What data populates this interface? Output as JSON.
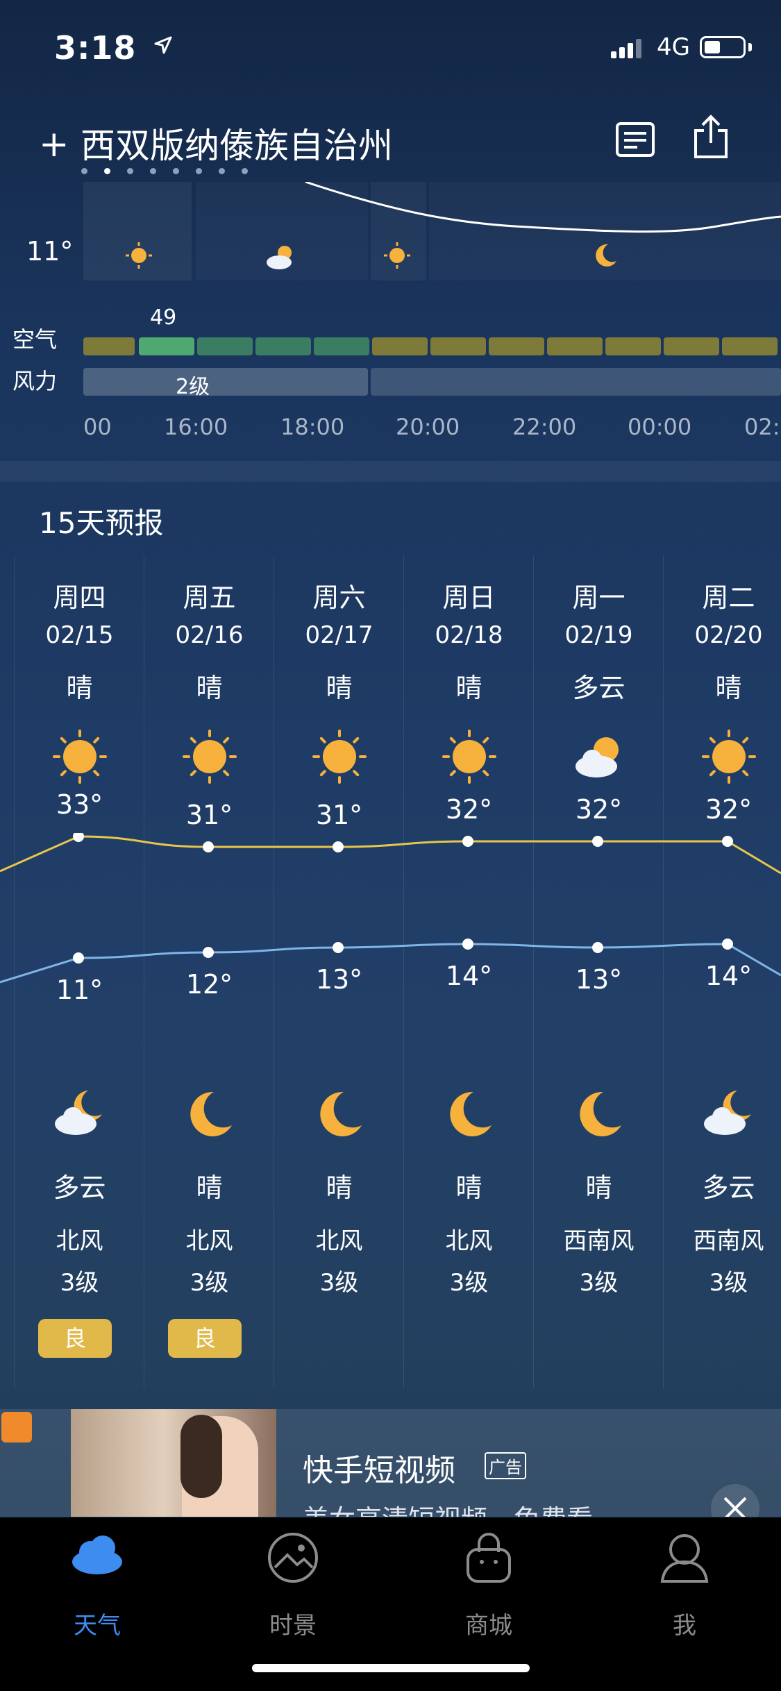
{
  "status": {
    "time": "3:18",
    "network": "4G"
  },
  "header": {
    "city": "西双版纳傣族自治州",
    "add_label": "+",
    "page_count": 8,
    "active_page": 1
  },
  "hourly": {
    "low_temp": "11°",
    "air_label": "空气",
    "wind_label": "风力",
    "aqi_value": "49",
    "wind_level": "2级",
    "times": [
      "00",
      "16:00",
      "18:00",
      "20:00",
      "22:00",
      "00:00",
      "02:"
    ],
    "colors": {
      "aqi_moderate": "#7d7a3a",
      "aqi_good_bright": "#4fa86f",
      "aqi_good": "#3a7d62"
    }
  },
  "forecast": {
    "title": "15天预报",
    "days": [
      {
        "day": "周四",
        "date": "02/15",
        "cond_day": "晴",
        "icon_day": "sun-icon",
        "high": "33°",
        "high_val": 33,
        "low": "11°",
        "low_val": 11,
        "icon_night": "cloud-moon-icon",
        "cond_night": "多云",
        "wind_dir": "北风",
        "wind_lvl": "3级",
        "aqi": "良"
      },
      {
        "day": "周五",
        "date": "02/16",
        "cond_day": "晴",
        "icon_day": "sun-icon",
        "high": "31°",
        "high_val": 31,
        "low": "12°",
        "low_val": 12,
        "icon_night": "moon-icon",
        "cond_night": "晴",
        "wind_dir": "北风",
        "wind_lvl": "3级",
        "aqi": "良"
      },
      {
        "day": "周六",
        "date": "02/17",
        "cond_day": "晴",
        "icon_day": "sun-icon",
        "high": "31°",
        "high_val": 31,
        "low": "13°",
        "low_val": 13,
        "icon_night": "moon-icon",
        "cond_night": "晴",
        "wind_dir": "北风",
        "wind_lvl": "3级",
        "aqi": ""
      },
      {
        "day": "周日",
        "date": "02/18",
        "cond_day": "晴",
        "icon_day": "sun-icon",
        "high": "32°",
        "high_val": 32,
        "low": "14°",
        "low_val": 14,
        "icon_night": "moon-icon",
        "cond_night": "晴",
        "wind_dir": "北风",
        "wind_lvl": "3级",
        "aqi": ""
      },
      {
        "day": "周一",
        "date": "02/19",
        "cond_day": "多云",
        "icon_day": "cloud-sun-icon",
        "high": "32°",
        "high_val": 32,
        "low": "13°",
        "low_val": 13,
        "icon_night": "moon-icon",
        "cond_night": "晴",
        "wind_dir": "西南风",
        "wind_lvl": "3级",
        "aqi": ""
      },
      {
        "day": "周二",
        "date": "02/20",
        "cond_day": "晴",
        "icon_day": "sun-icon",
        "high": "32°",
        "high_val": 32,
        "low": "14°",
        "low_val": 14,
        "icon_night": "cloud-moon-icon",
        "cond_night": "多云",
        "wind_dir": "西南风",
        "wind_lvl": "3级",
        "aqi": ""
      }
    ],
    "colors": {
      "high_line": "#e8c64a",
      "low_line": "#7fb6e6",
      "aqi_badge": "#e1b94a"
    }
  },
  "ad": {
    "title": "快手短视频",
    "tag": "广告",
    "subtitle": "美女高清短视频，免费看"
  },
  "tabbar": {
    "items": [
      {
        "label": "天气",
        "icon": "cloud-icon",
        "active": true
      },
      {
        "label": "时景",
        "icon": "photo-icon",
        "active": false
      },
      {
        "label": "商城",
        "icon": "shopping-bag-icon",
        "active": false
      },
      {
        "label": "我",
        "icon": "user-icon",
        "active": false
      }
    ],
    "active_color": "#3d8cf0",
    "inactive_color": "#8c8c8c"
  }
}
